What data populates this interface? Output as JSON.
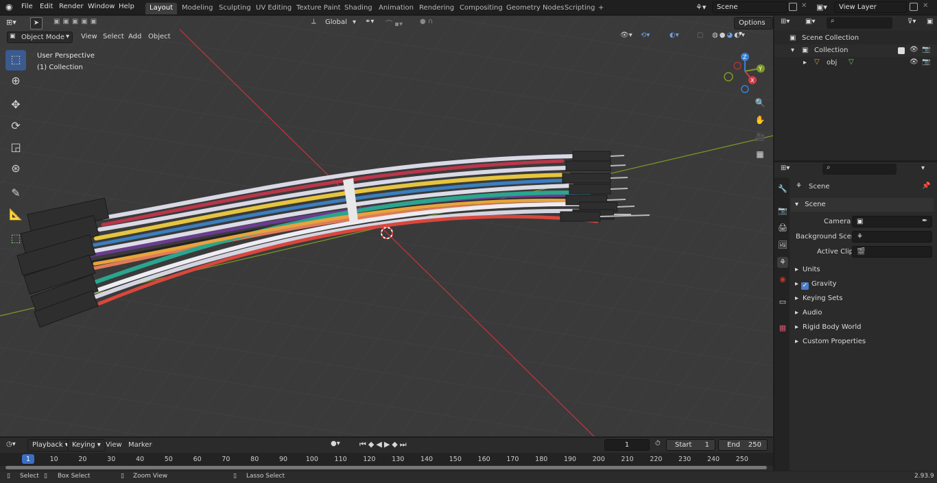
{
  "topbar": {
    "menus": [
      "File",
      "Edit",
      "Render",
      "Window",
      "Help"
    ],
    "workspaces": [
      "Layout",
      "Modeling",
      "Sculpting",
      "UV Editing",
      "Texture Paint",
      "Shading",
      "Animation",
      "Rendering",
      "Compositing",
      "Geometry Nodes",
      "Scripting"
    ],
    "active_workspace": "Layout",
    "add_tab": "+",
    "scene": "Scene",
    "view_layer": "View Layer"
  },
  "viewport": {
    "mode": "Object Mode",
    "menus": [
      "View",
      "Select",
      "Add",
      "Object"
    ],
    "transform": "Global",
    "options": "Options",
    "perspective": "User Perspective",
    "collection": "(1) Collection",
    "gizmo": {
      "z": "Z",
      "y": "Y",
      "x": "X"
    }
  },
  "tools": [
    "select-box",
    "cursor",
    "move",
    "rotate",
    "scale",
    "transform",
    "annotate",
    "measure",
    "add-cube"
  ],
  "outliner": {
    "root": "Scene Collection",
    "collection": "Collection",
    "object": "obj"
  },
  "properties": {
    "context": "Scene",
    "section": "Scene",
    "camera_label": "Camera",
    "background_label": "Background Scene",
    "clip_label": "Active Clip",
    "panels": [
      "Units",
      "Gravity",
      "Keying Sets",
      "Audio",
      "Rigid Body World",
      "Custom Properties"
    ]
  },
  "timeline": {
    "menus": [
      "Playback",
      "Keying",
      "View",
      "Marker"
    ],
    "current_frame": "1",
    "start_label": "Start",
    "start": "1",
    "end_label": "End",
    "end": "250",
    "ticks": [
      "1",
      "10",
      "20",
      "30",
      "40",
      "50",
      "60",
      "70",
      "80",
      "90",
      "100",
      "110",
      "120",
      "130",
      "140",
      "150",
      "160",
      "170",
      "180",
      "190",
      "200",
      "210",
      "220",
      "230",
      "240",
      "250"
    ]
  },
  "status": {
    "select": "Select",
    "box_select": "Box Select",
    "zoom": "Zoom View",
    "lasso": "Lasso Select",
    "version": "2.93.9"
  },
  "colors": {
    "accent": "#3b5a8e",
    "viewport_bg": "#3a3a3a",
    "x_axis": "#b8333f",
    "y_axis": "#7d9b24"
  }
}
